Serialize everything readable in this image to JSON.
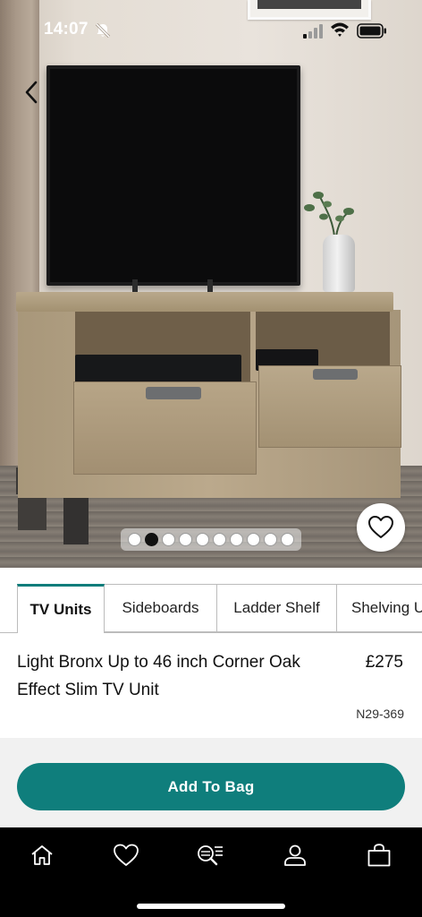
{
  "status_bar": {
    "time": "14:07",
    "icons": [
      "bell-slash-icon",
      "signal-icon",
      "wifi-icon",
      "battery-icon"
    ]
  },
  "hero": {
    "back_icon": "chevron-left-icon",
    "wishlist_icon": "heart-outline-icon",
    "carousel_total": 10,
    "carousel_active_index": 1
  },
  "tabs": [
    {
      "label": "TV Units",
      "active": true
    },
    {
      "label": "Sideboards",
      "active": false
    },
    {
      "label": "Ladder Shelf",
      "active": false
    },
    {
      "label": "Shelving U",
      "active": false
    }
  ],
  "product": {
    "name": "Light Bronx Up to 46 inch Corner Oak Effect Slim TV Unit",
    "price": "£275",
    "code": "N29-369"
  },
  "cta": {
    "add_to_bag_label": "Add To Bag"
  },
  "bottom_nav": {
    "items": [
      "home-icon",
      "heart-icon",
      "search-categories-icon",
      "account-icon",
      "bag-icon"
    ]
  },
  "colors": {
    "accent": "#0f7e7c",
    "nav_background": "#000000",
    "cta_area": "#f1f1f1"
  }
}
